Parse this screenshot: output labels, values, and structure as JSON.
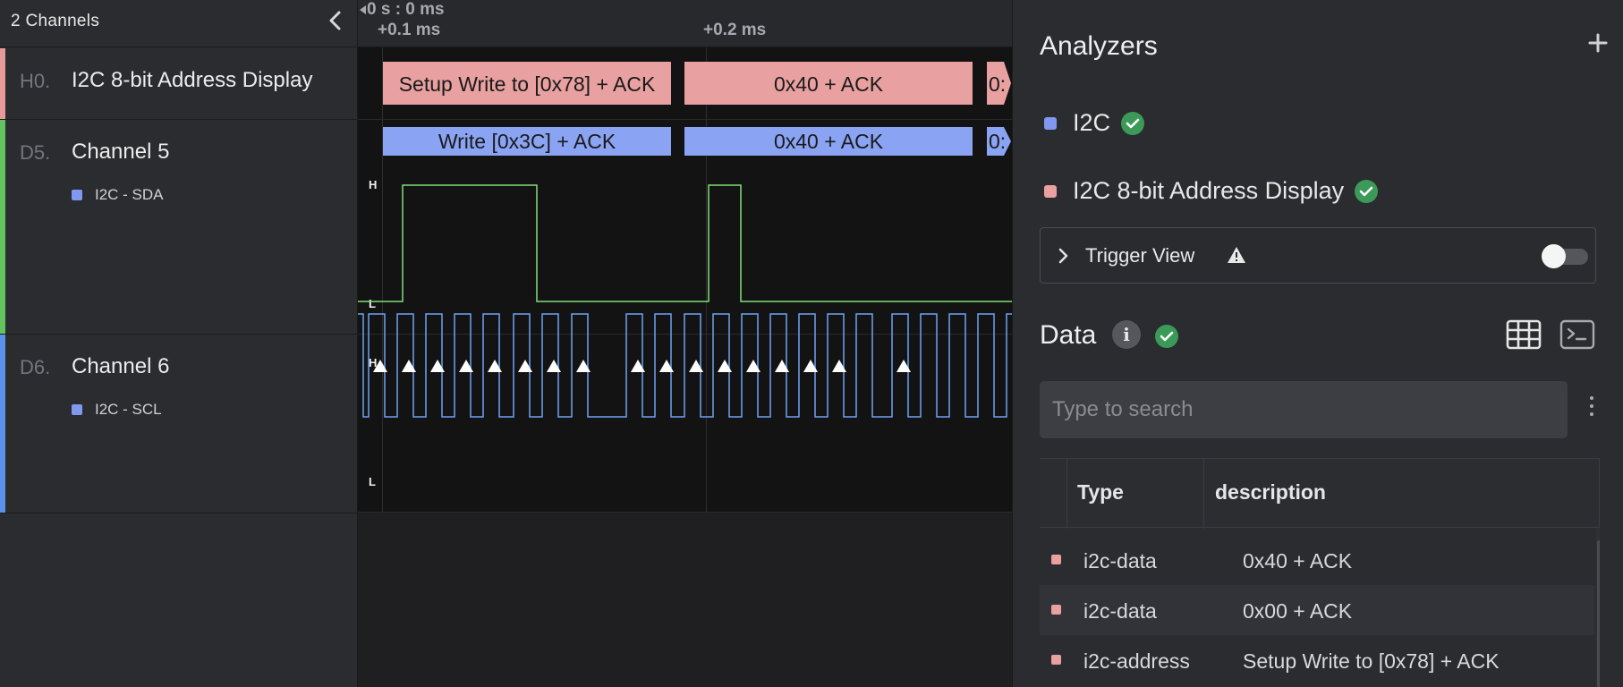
{
  "left_panel": {
    "title": "2 Channels",
    "channels": [
      {
        "id": "H0.",
        "name": "I2C 8-bit Address Display",
        "color": "#e79a9a"
      },
      {
        "id": "D5.",
        "name": "Channel 5",
        "sub": "I2C - SDA",
        "color": "#62c45e"
      },
      {
        "id": "D6.",
        "name": "Channel 6",
        "sub": "I2C - SCL",
        "color": "#5b91e8"
      }
    ]
  },
  "timeline": {
    "origin_label": "0 s : 0 ms",
    "ticks": [
      "+0.1 ms",
      "+0.2 ms"
    ]
  },
  "waveforms": {
    "h0_frames": [
      "Setup Write to [0x78] + ACK",
      "0x40 + ACK",
      "0:"
    ],
    "h0_color": "#e8a0a0",
    "d5_frames": [
      "Write [0x3C] + ACK",
      "0x40 + ACK",
      "0:"
    ],
    "d5_frame_color": "#8aa3f3",
    "sda_color": "#80e07a",
    "scl_color": "#6ea3f5",
    "level_high": "H",
    "level_low": "L"
  },
  "analyzers": {
    "title": "Analyzers",
    "add_icon": "plus-icon",
    "items": [
      {
        "name": "I2C",
        "color": "#8098f0",
        "status_icon": "check-circle-icon"
      },
      {
        "name": "I2C 8-bit Address Display",
        "color": "#e8a0a0",
        "status_icon": "check-circle-icon"
      }
    ]
  },
  "trigger_view": {
    "label": "Trigger View",
    "warning_icon": "warning-icon",
    "enabled": false
  },
  "data_section": {
    "title": "Data",
    "info_icon": "info-icon",
    "info_glyph": "i",
    "table_icon": "table-icon",
    "terminal_icon": "terminal-icon",
    "search_placeholder": "Type to search",
    "columns": [
      "Type",
      "description"
    ],
    "rows": [
      {
        "type": "i2c-data",
        "description": "0x40 + ACK"
      },
      {
        "type": "i2c-data",
        "description": "0x00 + ACK"
      },
      {
        "type": "i2c-address",
        "description": "Setup Write to [0x78] + ACK"
      }
    ]
  }
}
